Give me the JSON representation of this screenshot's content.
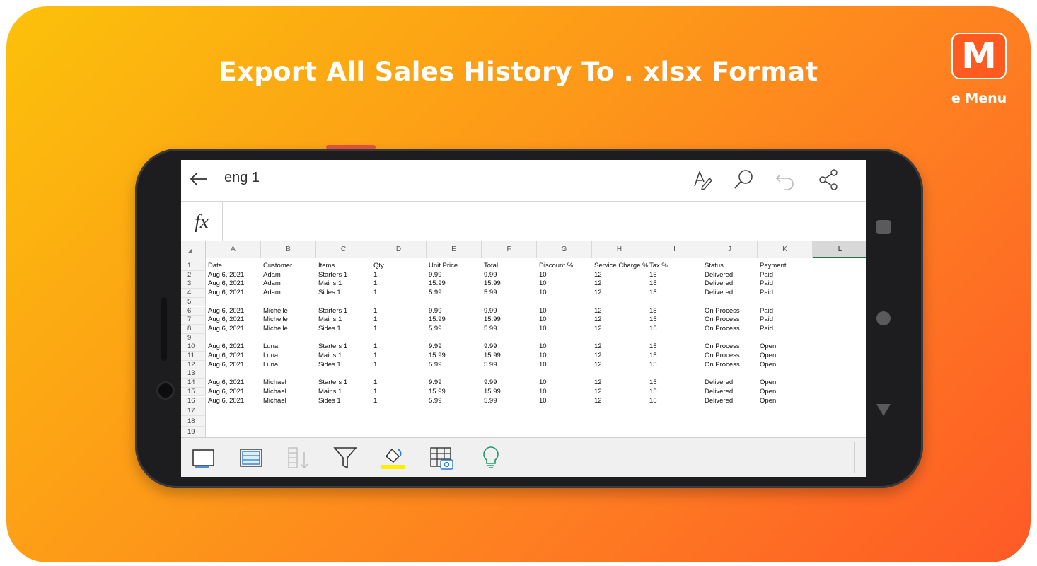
{
  "banner": {
    "headline": "Export All Sales History To . xlsx Format",
    "logo_letter": "M",
    "logo_text": "e Menu",
    "colors": {
      "gradient_start": "#fcc10a",
      "gradient_end": "#fe5a26",
      "logo_fill": "#ff5a1f"
    }
  },
  "app": {
    "title": "eng 1",
    "toolbar_icons": [
      "back-arrow-icon",
      "pen-edit-icon",
      "search-icon",
      "undo-icon",
      "share-icon"
    ],
    "formula_label": "fx",
    "formula_value": "",
    "selected_column": "L",
    "accent": "#217346"
  },
  "sheet": {
    "columns": [
      "A",
      "B",
      "C",
      "D",
      "E",
      "F",
      "G",
      "H",
      "I",
      "J",
      "K",
      "L"
    ],
    "row_numbers": [
      "1",
      "2",
      "3",
      "4",
      "5",
      "6",
      "7",
      "8",
      "9",
      "10",
      "11",
      "12",
      "13",
      "14",
      "15",
      "16",
      "17",
      "18",
      "19"
    ],
    "rows": [
      [
        "Date",
        "Customer",
        "Items",
        "Qty",
        "Unit Price",
        "Total",
        "Discount %",
        "Service Charge %",
        "Tax %",
        "Status",
        "Payment"
      ],
      [
        "Aug 6, 2021",
        "Adam",
        "Starters 1",
        "1",
        "9.99",
        "9.99",
        "10",
        "12",
        "15",
        "Delivered",
        "Paid"
      ],
      [
        "Aug 6, 2021",
        "Adam",
        "Mains 1",
        "1",
        "15.99",
        "15.99",
        "10",
        "12",
        "15",
        "Delivered",
        "Paid"
      ],
      [
        "Aug 6, 2021",
        "Adam",
        "Sides 1",
        "1",
        "5.99",
        "5.99",
        "10",
        "12",
        "15",
        "Delivered",
        "Paid"
      ],
      [],
      [
        "Aug 6, 2021",
        "Michelle",
        "Starters 1",
        "1",
        "9.99",
        "9.99",
        "10",
        "12",
        "15",
        "On Process",
        "Paid"
      ],
      [
        "Aug 6, 2021",
        "Michelle",
        "Mains 1",
        "1",
        "15.99",
        "15.99",
        "10",
        "12",
        "15",
        "On Process",
        "Paid"
      ],
      [
        "Aug 6, 2021",
        "Michelle",
        "Sides 1",
        "1",
        "5.99",
        "5.99",
        "10",
        "12",
        "15",
        "On Process",
        "Paid"
      ],
      [],
      [
        "Aug 6, 2021",
        "Luna",
        "Starters 1",
        "1",
        "9.99",
        "9.99",
        "10",
        "12",
        "15",
        "On Process",
        "Open"
      ],
      [
        "Aug 6, 2021",
        "Luna",
        "Mains 1",
        "1",
        "15.99",
        "15.99",
        "10",
        "12",
        "15",
        "On Process",
        "Open"
      ],
      [
        "Aug 6, 2021",
        "Luna",
        "Sides 1",
        "1",
        "5.99",
        "5.99",
        "10",
        "12",
        "15",
        "On Process",
        "Open"
      ],
      [],
      [
        "Aug 6, 2021",
        "Michael",
        "Starters 1",
        "1",
        "9.99",
        "9.99",
        "10",
        "12",
        "15",
        "Delivered",
        "Open"
      ],
      [
        "Aug 6, 2021",
        "Michael",
        "Mains 1",
        "1",
        "15.99",
        "15.99",
        "10",
        "12",
        "15",
        "Delivered",
        "Open"
      ],
      [
        "Aug 6, 2021",
        "Michael",
        "Sides 1",
        "1",
        "5.99",
        "5.99",
        "10",
        "12",
        "15",
        "Delivered",
        "Open"
      ],
      [],
      [],
      []
    ]
  },
  "bottom_toolbar": {
    "icons": [
      "sheet-view-icon",
      "freeze-panes-icon",
      "sort-icon",
      "filter-icon",
      "fill-color-icon",
      "table-image-icon",
      "ideas-icon"
    ],
    "fill_highlight": "#ffee00"
  }
}
